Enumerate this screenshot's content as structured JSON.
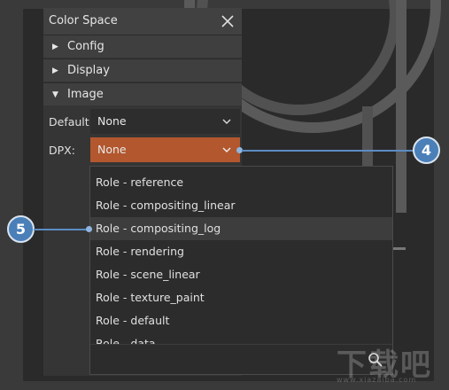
{
  "dialog": {
    "title": "Color Space",
    "sections": [
      {
        "label": "Config",
        "expanded": false
      },
      {
        "label": "Display",
        "expanded": false
      },
      {
        "label": "Image",
        "expanded": true
      }
    ],
    "default_label": "Default:",
    "default_value": "None",
    "dpx_label": "DPX:",
    "dpx_value": "None"
  },
  "dropdown": {
    "options": [
      "Role - reference",
      "Role - compositing_linear",
      "Role - compositing_log",
      "Role - rendering",
      "Role - scene_linear",
      "Role - texture_paint",
      "Role - default",
      "Role - data"
    ],
    "highlighted_index": 2
  },
  "callouts": {
    "dpx_marker": "4",
    "option_marker": "5"
  },
  "watermark": {
    "text": "下载吧",
    "subtext": "www.xiazaiba.com"
  },
  "colors": {
    "accent": "#b2572e",
    "callout": "#4a7fb8"
  }
}
